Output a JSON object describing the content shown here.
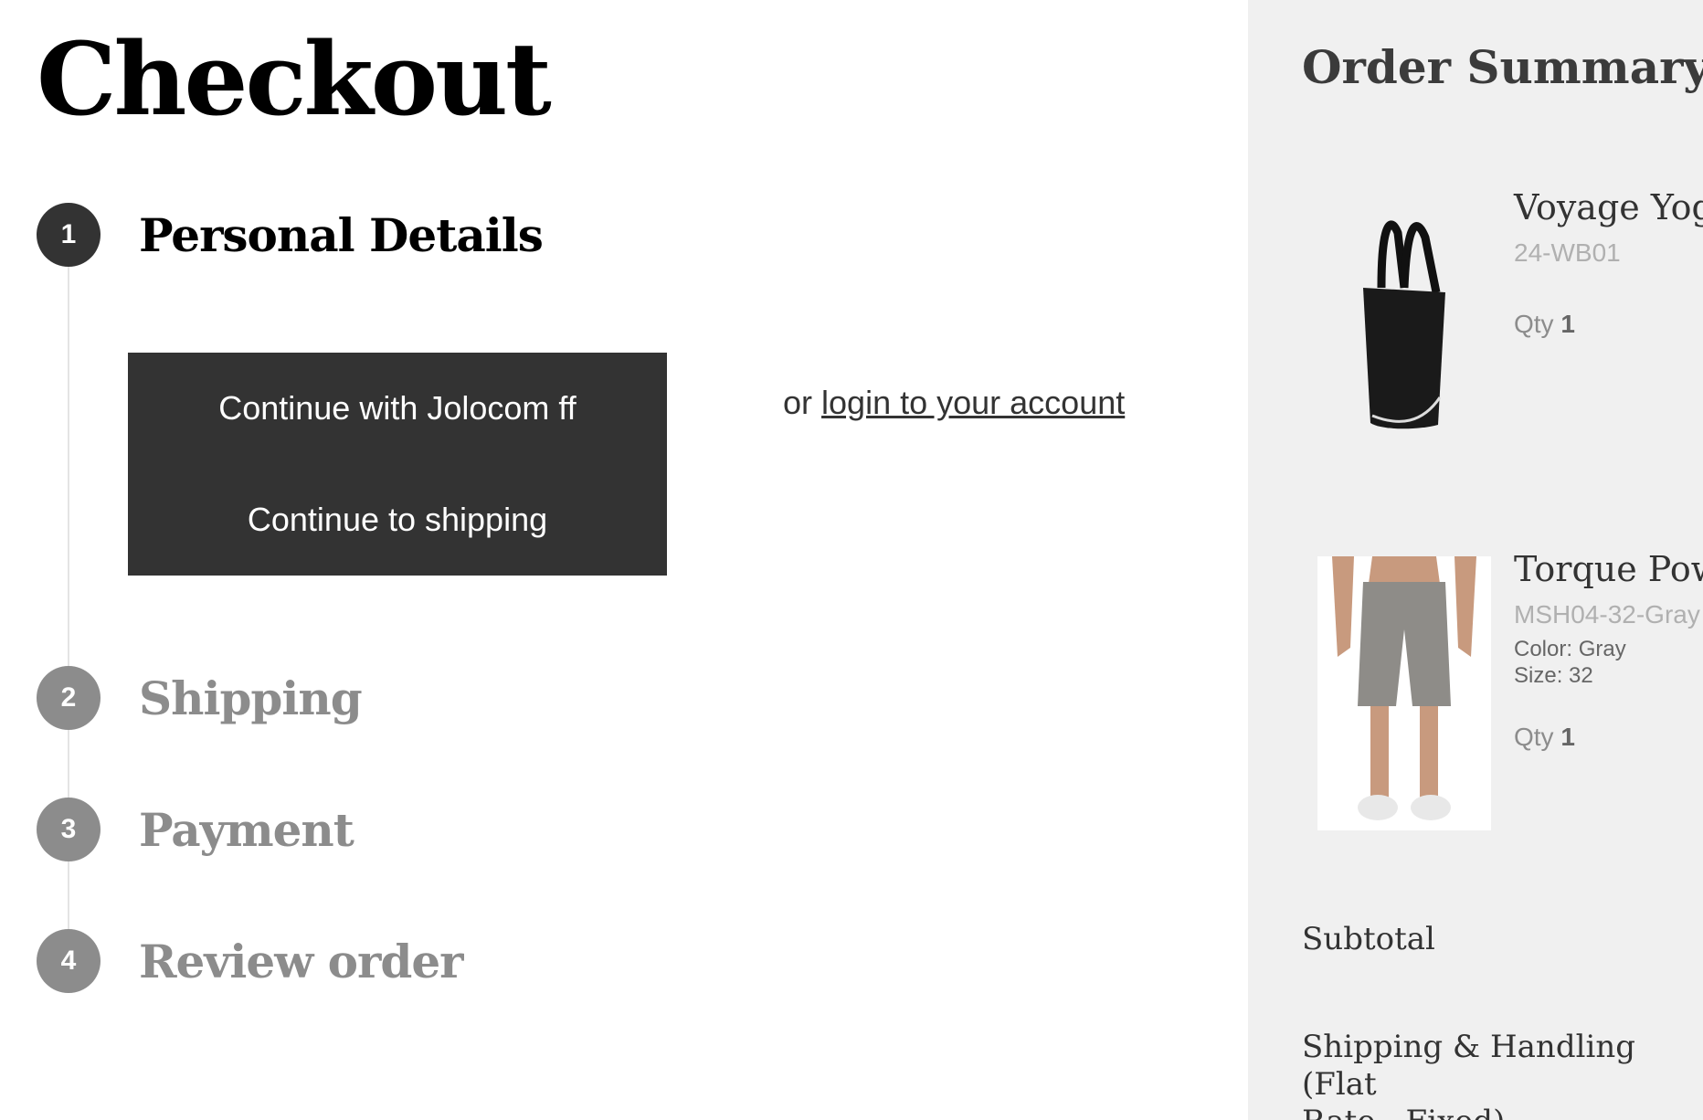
{
  "page": {
    "title": "Checkout"
  },
  "steps": [
    {
      "number": "1",
      "label": "Personal Details",
      "active": true
    },
    {
      "number": "2",
      "label": "Shipping",
      "active": false
    },
    {
      "number": "3",
      "label": "Payment",
      "active": false
    },
    {
      "number": "4",
      "label": "Review order",
      "active": false
    }
  ],
  "personal": {
    "jolocom_button": "Continue with Jolocom ff",
    "shipping_button": "Continue to shipping",
    "login_prefix": "or",
    "login_link": "login to your account"
  },
  "summary": {
    "title": "Order Summary",
    "items": [
      {
        "name": "Voyage Yoga",
        "sku": "24-WB01",
        "options": [],
        "qty_label": "Qty",
        "qty": "1",
        "thumb": "black-tote-bag"
      },
      {
        "name": "Torque Powe",
        "sku": "MSH04-32-Gray",
        "options": [
          "Color: Gray",
          "Size: 32"
        ],
        "qty_label": "Qty",
        "qty": "1",
        "thumb": "gray-shorts"
      }
    ],
    "subtotal_label": "Subtotal",
    "shipping_label_line1": "Shipping & Handling (Flat",
    "shipping_label_line2": "Rate - Fixed)"
  },
  "colors": {
    "active_step": "#333333",
    "inactive_step": "#8c8c8c",
    "button_bg": "#333333",
    "summary_bg": "#f0f0f0"
  }
}
